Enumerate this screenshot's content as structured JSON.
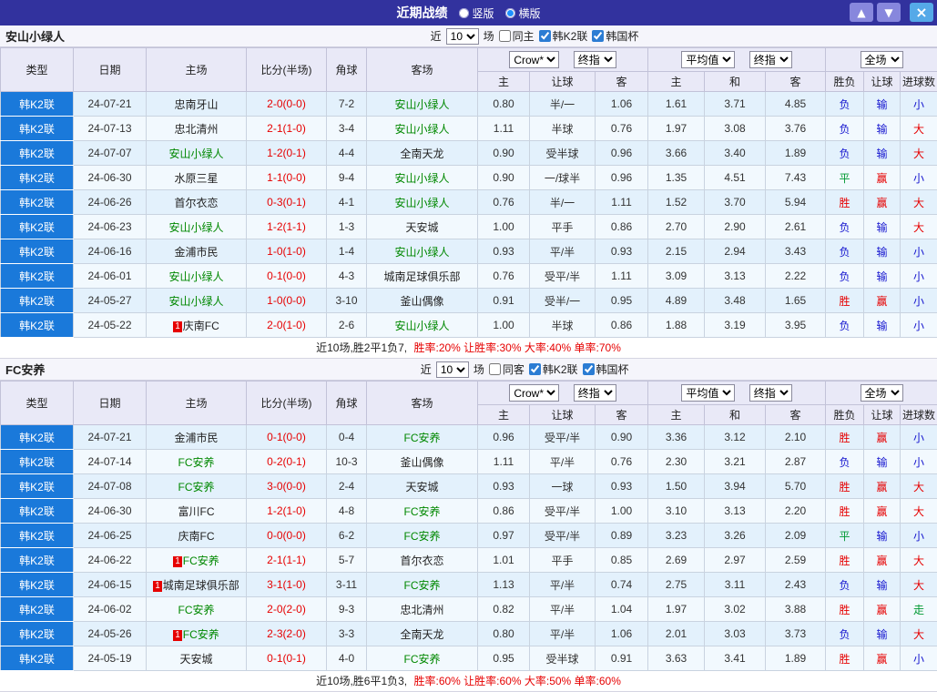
{
  "titlebar": {
    "title": "近期战绩",
    "vertical_label": "竖版",
    "vertical_selected": false,
    "horizontal_label": "横版",
    "horizontal_selected": true,
    "up_icon": "▲",
    "down_icon": "▼",
    "close_icon": "×"
  },
  "colors": {
    "titlebar_bg": "#32329e",
    "league_cell_bg": "#1a79da",
    "win_red": "#e60000",
    "draw_green": "#009933",
    "lose_blue": "#1515cf",
    "team_green": "#008800",
    "row_blue": "#e3f1fc"
  },
  "sections": [
    {
      "team": "安山小绿人",
      "filter": {
        "near_label": "近",
        "count": "10",
        "games_label": "场",
        "same_label": "同主",
        "same_checked": false,
        "league1": "韩K2联",
        "league1_checked": true,
        "league2": "韩国杯",
        "league2_checked": true
      },
      "header": {
        "type": "类型",
        "date": "日期",
        "home": "主场",
        "score": "比分(半场)",
        "corner": "角球",
        "away": "客场",
        "book_select": "Crow*",
        "final_select1": "终指",
        "avg_select": "平均值",
        "final_select2": "终指",
        "scope_select": "全场",
        "sub1": [
          "主",
          "让球",
          "客"
        ],
        "sub2": [
          "主",
          "和",
          "客"
        ],
        "sub3": [
          "胜负",
          "让球",
          "进球数"
        ]
      },
      "rows": [
        {
          "league": "韩K2联",
          "date": "24-07-21",
          "home": "忠南牙山",
          "home_is_team": false,
          "home_badge": "",
          "score": "2-0(0-0)",
          "corner": "7-2",
          "away": "安山小绿人",
          "away_is_team": true,
          "away_badge": "",
          "handicap": [
            "0.80",
            "半/一",
            "1.06"
          ],
          "europe": [
            "1.61",
            "3.71",
            "4.85"
          ],
          "results": [
            "负",
            "输",
            "小"
          ]
        },
        {
          "league": "韩K2联",
          "date": "24-07-13",
          "home": "忠北清州",
          "home_is_team": false,
          "home_badge": "",
          "score": "2-1(1-0)",
          "corner": "3-4",
          "away": "安山小绿人",
          "away_is_team": true,
          "away_badge": "",
          "handicap": [
            "1.11",
            "半球",
            "0.76"
          ],
          "europe": [
            "1.97",
            "3.08",
            "3.76"
          ],
          "results": [
            "负",
            "输",
            "大"
          ]
        },
        {
          "league": "韩K2联",
          "date": "24-07-07",
          "home": "安山小绿人",
          "home_is_team": true,
          "home_badge": "",
          "score": "1-2(0-1)",
          "corner": "4-4",
          "away": "全南天龙",
          "away_is_team": false,
          "away_badge": "",
          "handicap": [
            "0.90",
            "受半球",
            "0.96"
          ],
          "europe": [
            "3.66",
            "3.40",
            "1.89"
          ],
          "results": [
            "负",
            "输",
            "大"
          ]
        },
        {
          "league": "韩K2联",
          "date": "24-06-30",
          "home": "水原三星",
          "home_is_team": false,
          "home_badge": "",
          "score": "1-1(0-0)",
          "corner": "9-4",
          "away": "安山小绿人",
          "away_is_team": true,
          "away_badge": "",
          "handicap": [
            "0.90",
            "一/球半",
            "0.96"
          ],
          "europe": [
            "1.35",
            "4.51",
            "7.43"
          ],
          "results": [
            "平",
            "赢",
            "小"
          ]
        },
        {
          "league": "韩K2联",
          "date": "24-06-26",
          "home": "首尔衣恋",
          "home_is_team": false,
          "home_badge": "",
          "score": "0-3(0-1)",
          "corner": "4-1",
          "away": "安山小绿人",
          "away_is_team": true,
          "away_badge": "",
          "handicap": [
            "0.76",
            "半/一",
            "1.11"
          ],
          "europe": [
            "1.52",
            "3.70",
            "5.94"
          ],
          "results": [
            "胜",
            "赢",
            "大"
          ]
        },
        {
          "league": "韩K2联",
          "date": "24-06-23",
          "home": "安山小绿人",
          "home_is_team": true,
          "home_badge": "",
          "score": "1-2(1-1)",
          "corner": "1-3",
          "away": "天安城",
          "away_is_team": false,
          "away_badge": "",
          "handicap": [
            "1.00",
            "平手",
            "0.86"
          ],
          "europe": [
            "2.70",
            "2.90",
            "2.61"
          ],
          "results": [
            "负",
            "输",
            "大"
          ]
        },
        {
          "league": "韩K2联",
          "date": "24-06-16",
          "home": "金浦市民",
          "home_is_team": false,
          "home_badge": "",
          "score": "1-0(1-0)",
          "corner": "1-4",
          "away": "安山小绿人",
          "away_is_team": true,
          "away_badge": "",
          "handicap": [
            "0.93",
            "平/半",
            "0.93"
          ],
          "europe": [
            "2.15",
            "2.94",
            "3.43"
          ],
          "results": [
            "负",
            "输",
            "小"
          ]
        },
        {
          "league": "韩K2联",
          "date": "24-06-01",
          "home": "安山小绿人",
          "home_is_team": true,
          "home_badge": "",
          "score": "0-1(0-0)",
          "corner": "4-3",
          "away": "城南足球俱乐部",
          "away_is_team": false,
          "away_badge": "",
          "handicap": [
            "0.76",
            "受平/半",
            "1.11"
          ],
          "europe": [
            "3.09",
            "3.13",
            "2.22"
          ],
          "results": [
            "负",
            "输",
            "小"
          ]
        },
        {
          "league": "韩K2联",
          "date": "24-05-27",
          "home": "安山小绿人",
          "home_is_team": true,
          "home_badge": "",
          "score": "1-0(0-0)",
          "corner": "3-10",
          "away": "釜山偶像",
          "away_is_team": false,
          "away_badge": "",
          "handicap": [
            "0.91",
            "受半/一",
            "0.95"
          ],
          "europe": [
            "4.89",
            "3.48",
            "1.65"
          ],
          "results": [
            "胜",
            "赢",
            "小"
          ]
        },
        {
          "league": "韩K2联",
          "date": "24-05-22",
          "home": "庆南FC",
          "home_is_team": false,
          "home_badge": "1",
          "score": "2-0(1-0)",
          "corner": "2-6",
          "away": "安山小绿人",
          "away_is_team": true,
          "away_badge": "",
          "handicap": [
            "1.00",
            "半球",
            "0.86"
          ],
          "europe": [
            "1.88",
            "3.19",
            "3.95"
          ],
          "results": [
            "负",
            "输",
            "小"
          ]
        }
      ],
      "summary_prefix": "近10场,胜2平1负7,",
      "summary_stats": "胜率:20% 让胜率:30% 大率:40% 单率:70%"
    },
    {
      "team": "FC安养",
      "filter": {
        "near_label": "近",
        "count": "10",
        "games_label": "场",
        "same_label": "同客",
        "same_checked": false,
        "league1": "韩K2联",
        "league1_checked": true,
        "league2": "韩国杯",
        "league2_checked": true
      },
      "header": {
        "type": "类型",
        "date": "日期",
        "home": "主场",
        "score": "比分(半场)",
        "corner": "角球",
        "away": "客场",
        "book_select": "Crow*",
        "final_select1": "终指",
        "avg_select": "平均值",
        "final_select2": "终指",
        "scope_select": "全场",
        "sub1": [
          "主",
          "让球",
          "客"
        ],
        "sub2": [
          "主",
          "和",
          "客"
        ],
        "sub3": [
          "胜负",
          "让球",
          "进球数"
        ]
      },
      "rows": [
        {
          "league": "韩K2联",
          "date": "24-07-21",
          "home": "金浦市民",
          "home_is_team": false,
          "home_badge": "",
          "score": "0-1(0-0)",
          "corner": "0-4",
          "away": "FC安养",
          "away_is_team": true,
          "away_badge": "",
          "handicap": [
            "0.96",
            "受平/半",
            "0.90"
          ],
          "europe": [
            "3.36",
            "3.12",
            "2.10"
          ],
          "results": [
            "胜",
            "赢",
            "小"
          ]
        },
        {
          "league": "韩K2联",
          "date": "24-07-14",
          "home": "FC安养",
          "home_is_team": true,
          "home_badge": "",
          "score": "0-2(0-1)",
          "corner": "10-3",
          "away": "釜山偶像",
          "away_is_team": false,
          "away_badge": "",
          "handicap": [
            "1.11",
            "平/半",
            "0.76"
          ],
          "europe": [
            "2.30",
            "3.21",
            "2.87"
          ],
          "results": [
            "负",
            "输",
            "小"
          ]
        },
        {
          "league": "韩K2联",
          "date": "24-07-08",
          "home": "FC安养",
          "home_is_team": true,
          "home_badge": "",
          "score": "3-0(0-0)",
          "corner": "2-4",
          "away": "天安城",
          "away_is_team": false,
          "away_badge": "",
          "handicap": [
            "0.93",
            "一球",
            "0.93"
          ],
          "europe": [
            "1.50",
            "3.94",
            "5.70"
          ],
          "results": [
            "胜",
            "赢",
            "大"
          ]
        },
        {
          "league": "韩K2联",
          "date": "24-06-30",
          "home": "富川FC",
          "home_is_team": false,
          "home_badge": "",
          "score": "1-2(1-0)",
          "corner": "4-8",
          "away": "FC安养",
          "away_is_team": true,
          "away_badge": "",
          "handicap": [
            "0.86",
            "受平/半",
            "1.00"
          ],
          "europe": [
            "3.10",
            "3.13",
            "2.20"
          ],
          "results": [
            "胜",
            "赢",
            "大"
          ]
        },
        {
          "league": "韩K2联",
          "date": "24-06-25",
          "home": "庆南FC",
          "home_is_team": false,
          "home_badge": "",
          "score": "0-0(0-0)",
          "corner": "6-2",
          "away": "FC安养",
          "away_is_team": true,
          "away_badge": "",
          "handicap": [
            "0.97",
            "受平/半",
            "0.89"
          ],
          "europe": [
            "3.23",
            "3.26",
            "2.09"
          ],
          "results": [
            "平",
            "输",
            "小"
          ]
        },
        {
          "league": "韩K2联",
          "date": "24-06-22",
          "home": "FC安养",
          "home_is_team": true,
          "home_badge": "1",
          "score": "2-1(1-1)",
          "corner": "5-7",
          "away": "首尔衣恋",
          "away_is_team": false,
          "away_badge": "",
          "handicap": [
            "1.01",
            "平手",
            "0.85"
          ],
          "europe": [
            "2.69",
            "2.97",
            "2.59"
          ],
          "results": [
            "胜",
            "赢",
            "大"
          ]
        },
        {
          "league": "韩K2联",
          "date": "24-06-15",
          "home": "城南足球俱乐部",
          "home_is_team": false,
          "home_badge": "1",
          "score": "3-1(1-0)",
          "corner": "3-11",
          "away": "FC安养",
          "away_is_team": true,
          "away_badge": "",
          "handicap": [
            "1.13",
            "平/半",
            "0.74"
          ],
          "europe": [
            "2.75",
            "3.11",
            "2.43"
          ],
          "results": [
            "负",
            "输",
            "大"
          ]
        },
        {
          "league": "韩K2联",
          "date": "24-06-02",
          "home": "FC安养",
          "home_is_team": true,
          "home_badge": "",
          "score": "2-0(2-0)",
          "corner": "9-3",
          "away": "忠北清州",
          "away_is_team": false,
          "away_badge": "",
          "handicap": [
            "0.82",
            "平/半",
            "1.04"
          ],
          "europe": [
            "1.97",
            "3.02",
            "3.88"
          ],
          "results": [
            "胜",
            "赢",
            "走"
          ]
        },
        {
          "league": "韩K2联",
          "date": "24-05-26",
          "home": "FC安养",
          "home_is_team": true,
          "home_badge": "1",
          "score": "2-3(2-0)",
          "corner": "3-3",
          "away": "全南天龙",
          "away_is_team": false,
          "away_badge": "",
          "handicap": [
            "0.80",
            "平/半",
            "1.06"
          ],
          "europe": [
            "2.01",
            "3.03",
            "3.73"
          ],
          "results": [
            "负",
            "输",
            "大"
          ]
        },
        {
          "league": "韩K2联",
          "date": "24-05-19",
          "home": "天安城",
          "home_is_team": false,
          "home_badge": "",
          "score": "0-1(0-1)",
          "corner": "4-0",
          "away": "FC安养",
          "away_is_team": true,
          "away_badge": "",
          "handicap": [
            "0.95",
            "受半球",
            "0.91"
          ],
          "europe": [
            "3.63",
            "3.41",
            "1.89"
          ],
          "results": [
            "胜",
            "赢",
            "小"
          ]
        }
      ],
      "summary_prefix": "近10场,胜6平1负3,",
      "summary_stats": "胜率:60% 让胜率:60% 大率:50% 单率:60%"
    }
  ]
}
